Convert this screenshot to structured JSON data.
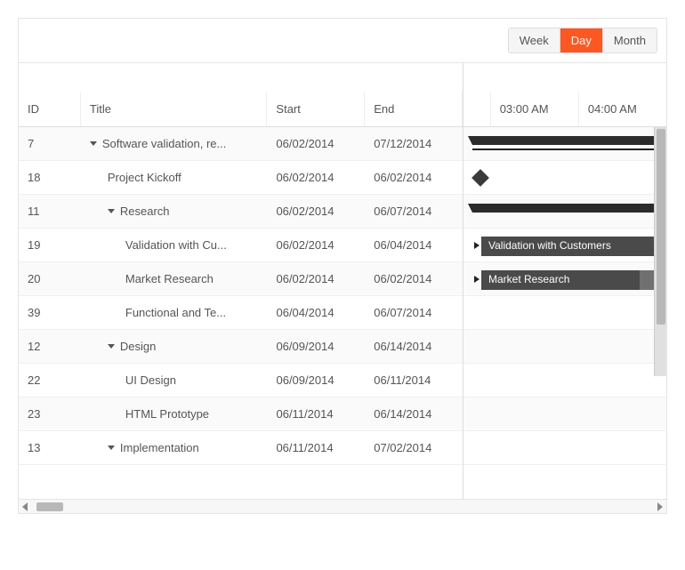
{
  "toolbar": {
    "views": [
      {
        "label": "Week",
        "active": false
      },
      {
        "label": "Day",
        "active": true
      },
      {
        "label": "Month",
        "active": false
      }
    ]
  },
  "columns": {
    "id": "ID",
    "title": "Title",
    "start": "Start",
    "end": "End"
  },
  "timeHeaders": [
    "03:00 AM",
    "04:00 AM"
  ],
  "rows": [
    {
      "id": "7",
      "title": "Software validation, re...",
      "start": "06/02/2014",
      "end": "07/12/2014",
      "indent": 0,
      "expandable": true,
      "bar": "summary-line"
    },
    {
      "id": "18",
      "title": "Project Kickoff",
      "start": "06/02/2014",
      "end": "06/02/2014",
      "indent": 1,
      "expandable": false,
      "bar": "milestone"
    },
    {
      "id": "11",
      "title": "Research",
      "start": "06/02/2014",
      "end": "06/07/2014",
      "indent": 1,
      "expandable": true,
      "bar": "summary"
    },
    {
      "id": "19",
      "title": "Validation with Cu...",
      "start": "06/02/2014",
      "end": "06/04/2014",
      "indent": 2,
      "expandable": false,
      "bar": "task",
      "barLabel": "Validation with Customers"
    },
    {
      "id": "20",
      "title": "Market Research",
      "start": "06/02/2014",
      "end": "06/02/2014",
      "indent": 2,
      "expandable": false,
      "bar": "task-progress",
      "barLabel": "Market Research"
    },
    {
      "id": "39",
      "title": "Functional and Te...",
      "start": "06/04/2014",
      "end": "06/07/2014",
      "indent": 2,
      "expandable": false,
      "bar": "none"
    },
    {
      "id": "12",
      "title": "Design",
      "start": "06/09/2014",
      "end": "06/14/2014",
      "indent": 1,
      "expandable": true,
      "bar": "none"
    },
    {
      "id": "22",
      "title": "UI Design",
      "start": "06/09/2014",
      "end": "06/11/2014",
      "indent": 2,
      "expandable": false,
      "bar": "none"
    },
    {
      "id": "23",
      "title": "HTML Prototype",
      "start": "06/11/2014",
      "end": "06/14/2014",
      "indent": 2,
      "expandable": false,
      "bar": "none"
    },
    {
      "id": "13",
      "title": "Implementation",
      "start": "06/11/2014",
      "end": "07/02/2014",
      "indent": 1,
      "expandable": true,
      "bar": "none"
    }
  ]
}
